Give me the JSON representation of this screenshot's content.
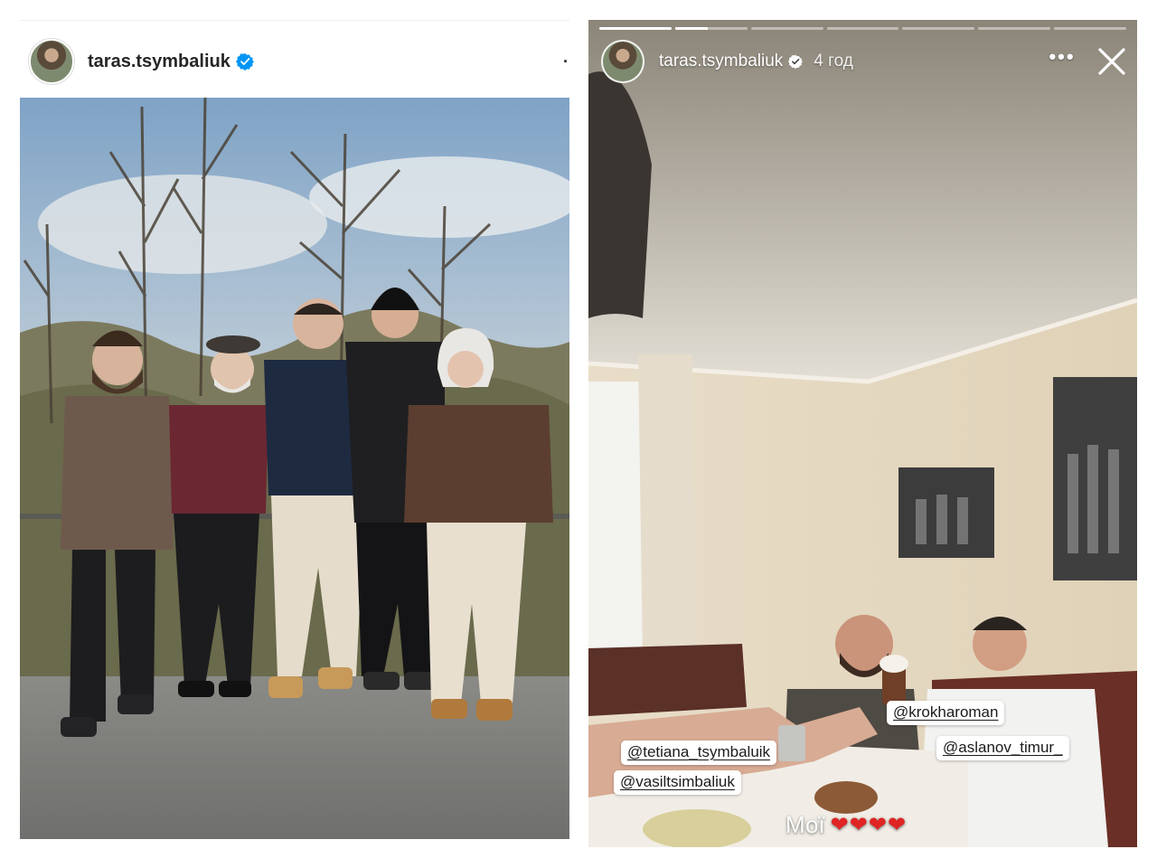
{
  "post": {
    "username": "taras.tsymbaliuk",
    "verified": true,
    "more_icon": "more-icon",
    "photo_alt": "Group photo of five people outdoors"
  },
  "story": {
    "username": "taras.tsymbaliuk",
    "verified": true,
    "time": "4 год",
    "progress_segments": 7,
    "progress_current": 1,
    "progress_current_fill": 0.45,
    "tags": {
      "tetiana": "@tetiana_tsymbaluik",
      "vasil": "@vasiltsimbaliuk",
      "krokharoman": "@krokharoman",
      "aslanov": "@aslanov_timur_"
    },
    "caption": {
      "text": "Мої",
      "hearts": "❤❤❤❤"
    }
  },
  "colors": {
    "verified_blue": "#0095f6",
    "heart_red": "#e02424",
    "text_dark": "#262626"
  }
}
